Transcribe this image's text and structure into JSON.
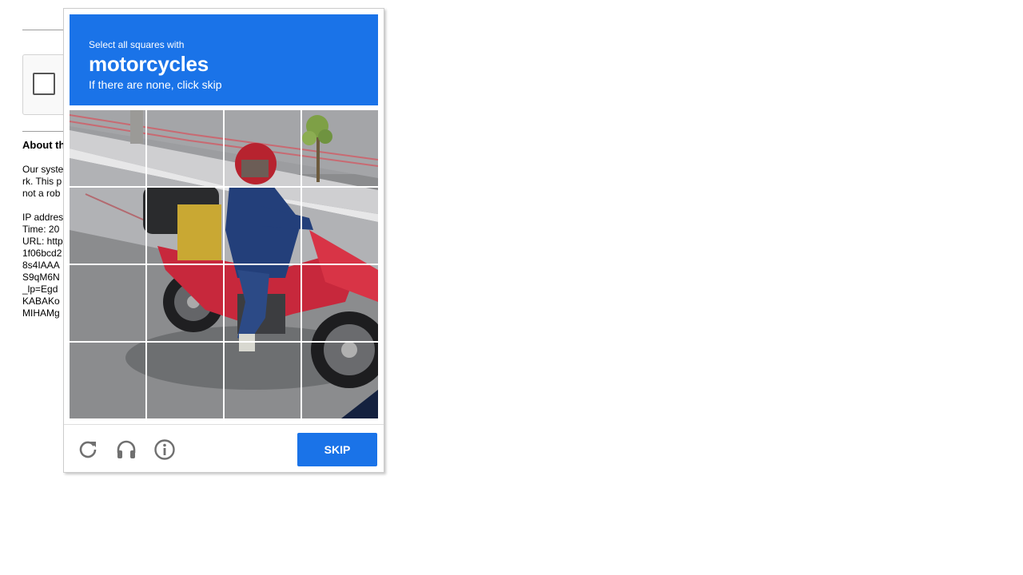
{
  "background_page": {
    "about_title": "About th",
    "about_lines": [
      "Our syste",
      "rk. This p",
      "not a rob",
      "",
      "IP addres",
      "Time: 20",
      "URL: http",
      "1f06bcd2",
      "8s4IAAA",
      "S9qM6N",
      "_lp=Egd",
      "KABAKo",
      "MIHAMg"
    ]
  },
  "challenge": {
    "instruction_small": "Select all squares with",
    "target_object": "motorcycles",
    "instruction_sub": "If there are none, click skip",
    "grid_rows": 4,
    "grid_cols": 4,
    "skip_label": "SKIP",
    "icons": [
      "reload-icon",
      "audio-headphones-icon",
      "info-icon"
    ],
    "colors": {
      "accent": "#1a73e8",
      "icon_gray": "#707070"
    }
  }
}
